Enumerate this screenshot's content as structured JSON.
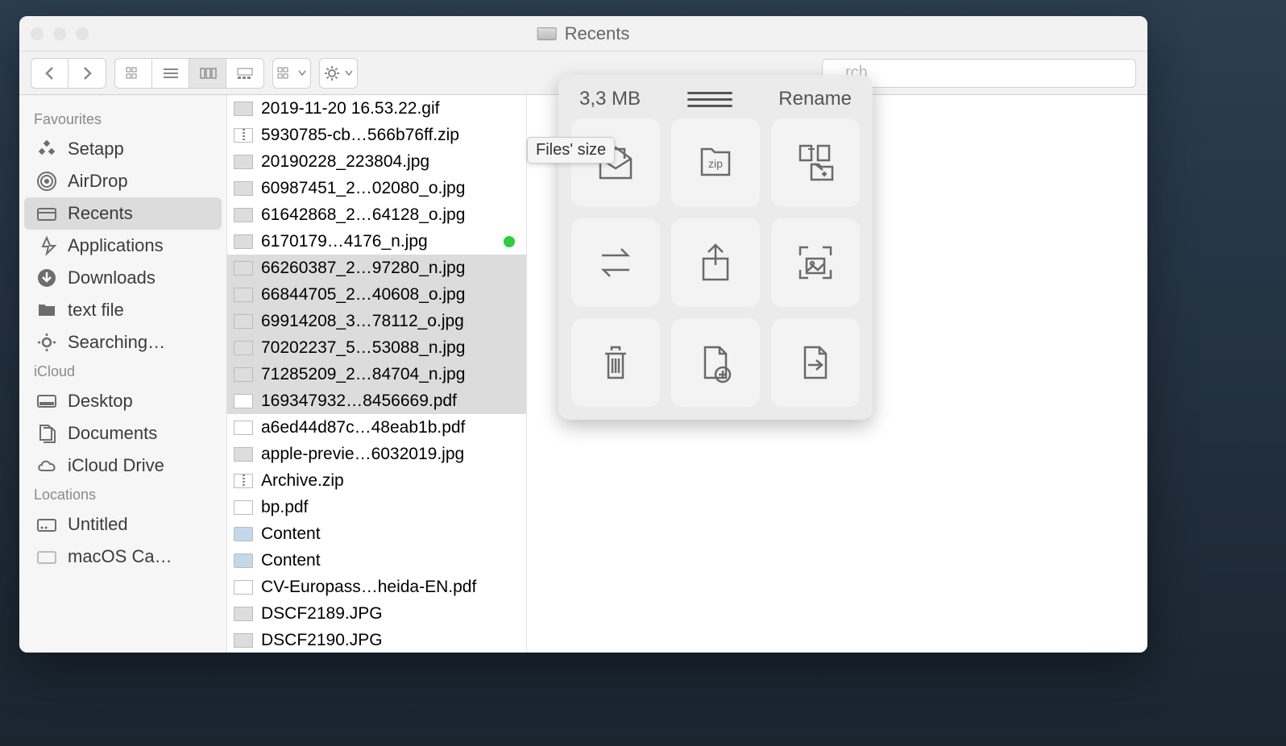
{
  "window": {
    "title": "Recents"
  },
  "toolbar": {
    "search_placeholder": "Search"
  },
  "sidebar": {
    "sections": [
      {
        "label": "Favourites",
        "items": [
          {
            "name": "Setapp"
          },
          {
            "name": "AirDrop"
          },
          {
            "name": "Recents",
            "active": true
          },
          {
            "name": "Applications"
          },
          {
            "name": "Downloads"
          },
          {
            "name": "text file"
          },
          {
            "name": "Searching…"
          }
        ]
      },
      {
        "label": "iCloud",
        "items": [
          {
            "name": "Desktop"
          },
          {
            "name": "Documents"
          },
          {
            "name": "iCloud Drive"
          }
        ]
      },
      {
        "label": "Locations",
        "items": [
          {
            "name": "Untitled"
          },
          {
            "name": "macOS Ca…"
          }
        ]
      }
    ]
  },
  "files": [
    {
      "name": "2019-11-20 16.53.22.gif",
      "type": "img"
    },
    {
      "name": "5930785-cb…566b76ff.zip",
      "type": "zip"
    },
    {
      "name": "20190228_223804.jpg",
      "type": "img"
    },
    {
      "name": "60987451_2…02080_o.jpg",
      "type": "img"
    },
    {
      "name": "61642868_2…64128_o.jpg",
      "type": "img"
    },
    {
      "name": "6170179…4176_n.jpg",
      "type": "img",
      "tag": "green"
    },
    {
      "name": "66260387_2…97280_n.jpg",
      "type": "img",
      "sel": true
    },
    {
      "name": "66844705_2…40608_o.jpg",
      "type": "img",
      "sel": true
    },
    {
      "name": "69914208_3…78112_o.jpg",
      "type": "img",
      "sel": true
    },
    {
      "name": "70202237_5…53088_n.jpg",
      "type": "img",
      "sel": true
    },
    {
      "name": "71285209_2…84704_n.jpg",
      "type": "img",
      "sel": true
    },
    {
      "name": "169347932…8456669.pdf",
      "type": "pdf",
      "sel": true
    },
    {
      "name": "a6ed44d87c…48eab1b.pdf",
      "type": "pdf"
    },
    {
      "name": "apple-previe…6032019.jpg",
      "type": "img"
    },
    {
      "name": "Archive.zip",
      "type": "zip"
    },
    {
      "name": "bp.pdf",
      "type": "pdf"
    },
    {
      "name": "Content",
      "type": "folder"
    },
    {
      "name": "Content",
      "type": "folder"
    },
    {
      "name": "CV-Europass…heida-EN.pdf",
      "type": "pdf"
    },
    {
      "name": "DSCF2189.JPG",
      "type": "img"
    },
    {
      "name": "DSCF2190.JPG",
      "type": "img"
    }
  ],
  "panel": {
    "size": "3,3 MB",
    "rename": "Rename",
    "tooltip": "Files' size",
    "tiles": [
      "mail",
      "zip",
      "copy-to-folder",
      "convert",
      "share",
      "image-dimensions",
      "trash",
      "new-file",
      "move-to"
    ]
  }
}
